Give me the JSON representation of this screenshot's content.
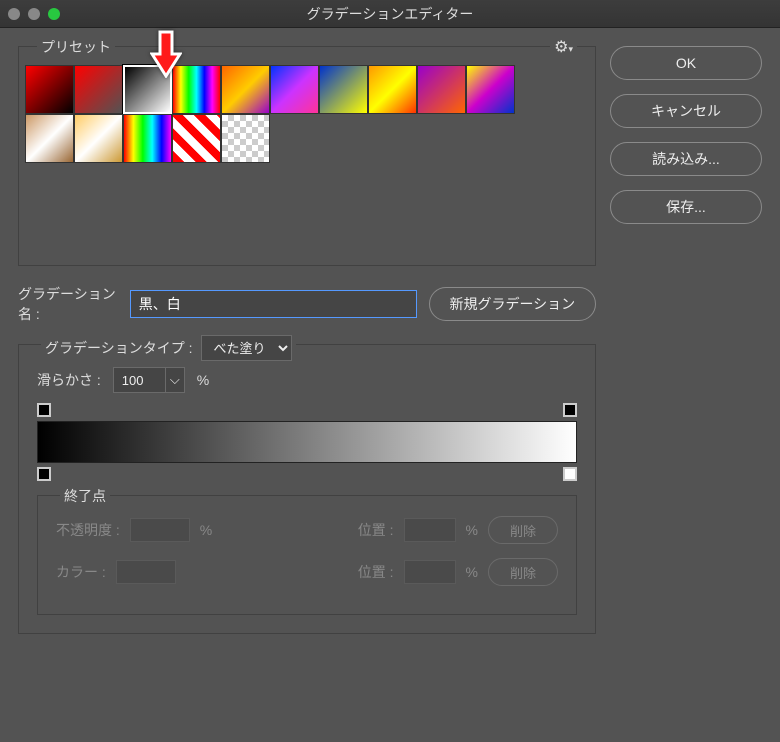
{
  "window": {
    "title": "グラデーションエディター"
  },
  "traffic": {
    "close": "#888888",
    "min": "#888888",
    "max": "#28c840"
  },
  "buttons": {
    "ok": "OK",
    "cancel": "キャンセル",
    "load": "読み込み...",
    "save": "保存...",
    "newGrad": "新規グラデーション"
  },
  "preset": {
    "label": "プリセット",
    "selectedIndex": 2,
    "swatches": [
      "linear-gradient(135deg,#ff0000,#000000)",
      "linear-gradient(135deg,#ff0000,rgba(255,0,0,0))",
      "linear-gradient(135deg,#000000,#ffffff)",
      "linear-gradient(to right,#ff0000,#ffff00,#00ff00,#00ffff,#0000ff,#ff00ff,#ff0000)",
      "linear-gradient(135deg,#ff6600,#ffcc00,#9900cc)",
      "linear-gradient(135deg,#0033ff,#cc33ff,#ff3399)",
      "linear-gradient(135deg,#0033cc,#ffff00)",
      "linear-gradient(135deg,#ff9900,#ffff00,#ff3300)",
      "linear-gradient(135deg,#9900cc,#ff6600)",
      "linear-gradient(135deg,#ffff00,#cc00cc,#0033cc)",
      "linear-gradient(135deg,#cc9966,#fff,#996633)",
      "linear-gradient(135deg,#ffcc66,#fff,#cc9933)",
      "linear-gradient(to right,#ff0000,#ffff00,#00ff00,#00ffff,#0000ff,#ff00ff)",
      "repeating-linear-gradient(45deg,#ff0000 0 8px,#ffffff 8px 16px)",
      ""
    ]
  },
  "gradName": {
    "label": "グラデーション名 :",
    "value": "黒、白"
  },
  "gtype": {
    "label": "グラデーションタイプ :",
    "value": "べた塗り",
    "smooth_label": "滑らかさ :",
    "smooth_value": "100",
    "smooth_unit": "%"
  },
  "stops": {
    "title": "終了点",
    "opacity_label": "不透明度 :",
    "opacity_unit": "%",
    "color_label": "カラー :",
    "pos_label": "位置 :",
    "pos_unit": "%",
    "delete": "削除"
  }
}
